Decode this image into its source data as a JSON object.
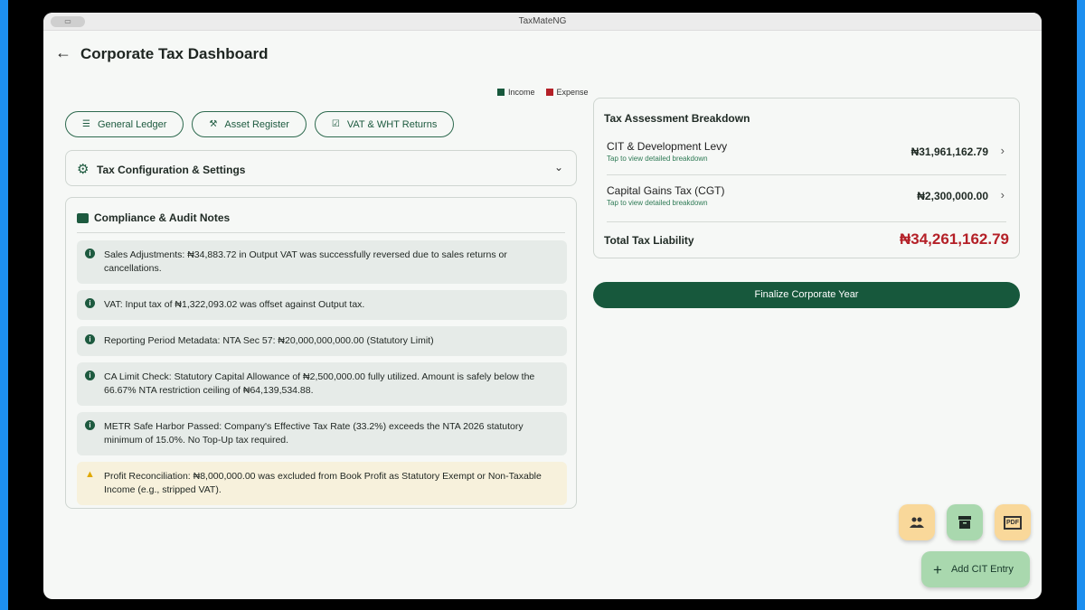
{
  "window": {
    "title": "TaxMateNG"
  },
  "header": {
    "title": "Corporate Tax Dashboard"
  },
  "chart_legend": {
    "income": "Income",
    "expense": "Expense",
    "income_color": "#17583c",
    "expense_color": "#b42027"
  },
  "chips": [
    {
      "label": "General Ledger",
      "icon": "list-icon"
    },
    {
      "label": "Asset Register",
      "icon": "asset-icon"
    },
    {
      "label": "VAT & WHT Returns",
      "icon": "checklist-icon"
    }
  ],
  "settings": {
    "label": "Tax Configuration & Settings"
  },
  "compliance": {
    "title": "Compliance & Audit Notes",
    "notes": [
      {
        "text": "Sales Adjustments: ₦34,883.72 in Output VAT was successfully reversed due to sales returns or cancellations.",
        "type": "info"
      },
      {
        "text": "VAT: Input tax of ₦1,322,093.02 was offset against Output tax.",
        "type": "info"
      },
      {
        "text": "Reporting Period Metadata: NTA Sec 57: ₦20,000,000,000.00 (Statutory Limit)",
        "type": "info"
      },
      {
        "text": "CA Limit Check: Statutory Capital Allowance of ₦2,500,000.00 fully utilized. Amount is safely below the 66.67% NTA restriction ceiling of ₦64,139,534.88.",
        "type": "info"
      },
      {
        "text": "METR Safe Harbor Passed: Company's Effective Tax Rate (33.2%) exceeds the NTA 2026 statutory minimum of 15.0%. No Top-Up tax required.",
        "type": "info"
      },
      {
        "text": "Profit Reconciliation: ₦8,000,000.00 was excluded from Book Profit as Statutory Exempt or Non-Taxable Income (e.g., stripped VAT).",
        "type": "warning"
      }
    ]
  },
  "breakdown": {
    "title": "Tax Assessment Breakdown",
    "rows": [
      {
        "name": "CIT & Development Levy",
        "sub": "Tap to view detailed breakdown",
        "amount": "₦31,961,162.79"
      },
      {
        "name": "Capital Gains Tax (CGT)",
        "sub": "Tap to view detailed breakdown",
        "amount": "₦2,300,000.00"
      }
    ],
    "total_label": "Total Tax Liability",
    "total_amount": "₦34,261,162.79"
  },
  "finalize_label": "Finalize Corporate Year",
  "fabs": {
    "people": "people-icon",
    "archive": "archive-icon",
    "pdf": "PDF"
  },
  "add_entry_label": "Add CIT Entry"
}
